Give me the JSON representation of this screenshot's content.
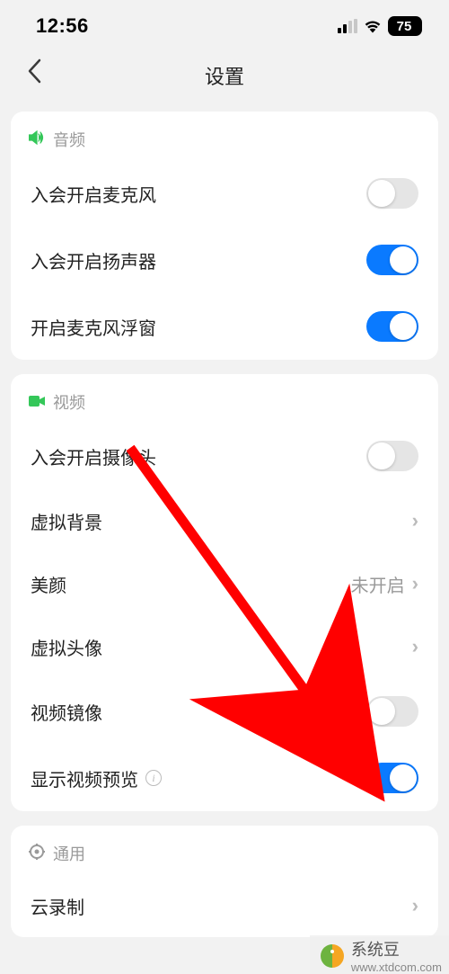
{
  "status": {
    "time": "12:56",
    "battery": "75"
  },
  "nav": {
    "title": "设置"
  },
  "sections": {
    "audio": {
      "header": "音频",
      "mic_on_join": "入会开启麦克风",
      "speaker_on_join": "入会开启扬声器",
      "mic_float": "开启麦克风浮窗"
    },
    "video": {
      "header": "视频",
      "camera_on_join": "入会开启摄像头",
      "virtual_bg": "虚拟背景",
      "beauty": "美颜",
      "beauty_value": "未开启",
      "virtual_avatar": "虚拟头像",
      "mirror": "视频镜像",
      "show_preview": "显示视频预览"
    },
    "general": {
      "header": "通用",
      "cloud_record": "云录制"
    }
  },
  "toggles": {
    "mic_on_join": false,
    "speaker_on_join": true,
    "mic_float": true,
    "camera_on_join": false,
    "mirror": false,
    "show_preview": true
  },
  "watermark": {
    "name": "系统豆",
    "url": "www.xtdcom.com"
  }
}
